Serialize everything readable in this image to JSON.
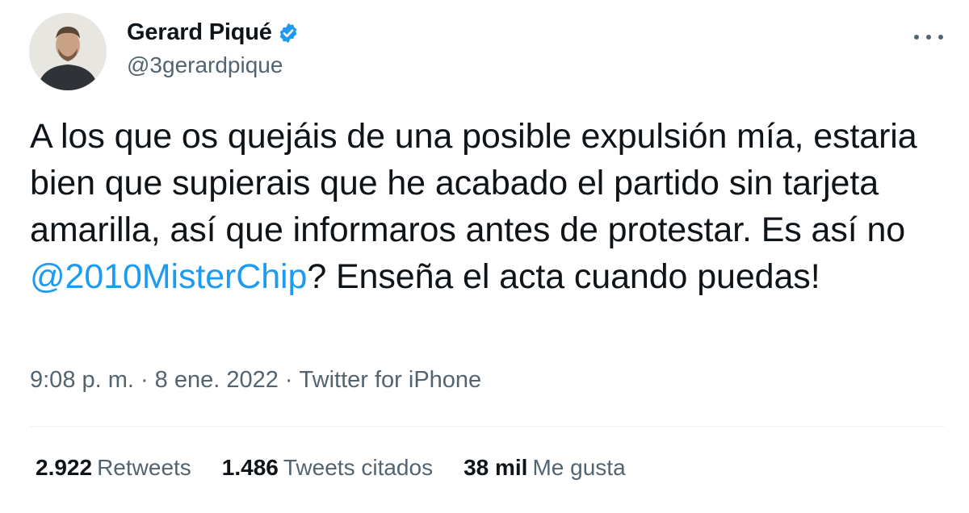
{
  "author": {
    "name": "Gerard Piqué",
    "handle": "@3gerardpique",
    "verified": true,
    "avatar_icon": "profile-photo"
  },
  "tweet": {
    "text_parts": {
      "before_mention": "A los que os quejáis de una posible expulsión mía, estaria bien que supierais que he acabado el partido sin tarjeta amarilla, así que informaros antes de protestar. Es así no ",
      "mention": "@2010MisterChip",
      "after_mention": "? Enseña el acta cuando puedas!"
    },
    "time": "9:08 p. m.",
    "separator": "·",
    "date": "8 ene. 2022",
    "source": "Twitter for iPhone"
  },
  "stats": {
    "retweets": {
      "count": "2.922",
      "label": "Retweets"
    },
    "quotes": {
      "count": "1.486",
      "label": "Tweets citados"
    },
    "likes": {
      "count": "38 mil",
      "label": "Me gusta"
    }
  },
  "colors": {
    "accent": "#1d9bf0",
    "text": "#0f1419",
    "muted": "#536471",
    "divider": "#eff3f4"
  }
}
